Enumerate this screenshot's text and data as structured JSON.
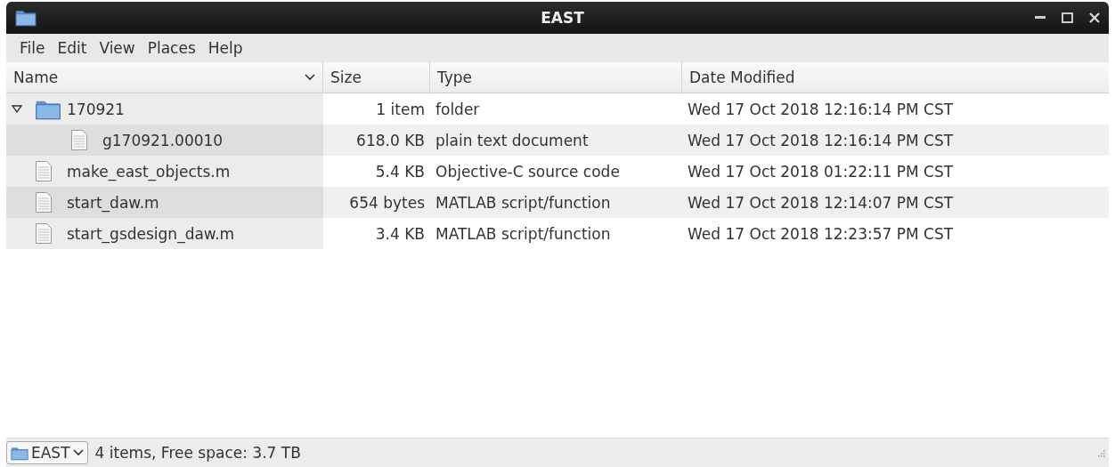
{
  "window": {
    "title": "EAST"
  },
  "menu": [
    "File",
    "Edit",
    "View",
    "Places",
    "Help"
  ],
  "table": {
    "columns": [
      {
        "label": "Name",
        "sorted": true
      },
      {
        "label": "Size",
        "sorted": false
      },
      {
        "label": "Type",
        "sorted": false
      },
      {
        "label": "Date Modified",
        "sorted": false
      }
    ],
    "rows": [
      {
        "kind": "folder",
        "name": "170921",
        "size": "1 item",
        "type": "folder",
        "modified": "Wed 17 Oct 2018 12:16:14 PM CST",
        "expanded": true,
        "children": [
          {
            "kind": "file",
            "name": "g170921.00010",
            "size": "618.0 KB",
            "type": "plain text document",
            "modified": "Wed 17 Oct 2018 12:16:14 PM CST"
          }
        ]
      },
      {
        "kind": "file",
        "name": "make_east_objects.m",
        "size": "5.4 KB",
        "type": "Objective-C source code",
        "modified": "Wed 17 Oct 2018 01:22:11 PM CST"
      },
      {
        "kind": "file",
        "name": "start_daw.m",
        "size": "654 bytes",
        "type": "MATLAB script/function",
        "modified": "Wed 17 Oct 2018 12:14:07 PM CST"
      },
      {
        "kind": "file",
        "name": "start_gsdesign_daw.m",
        "size": "3.4 KB",
        "type": "MATLAB script/function",
        "modified": "Wed 17 Oct 2018 12:23:57 PM CST"
      }
    ]
  },
  "status_bar": {
    "location": "EAST",
    "text": "4 items, Free space: 3.7 TB"
  }
}
